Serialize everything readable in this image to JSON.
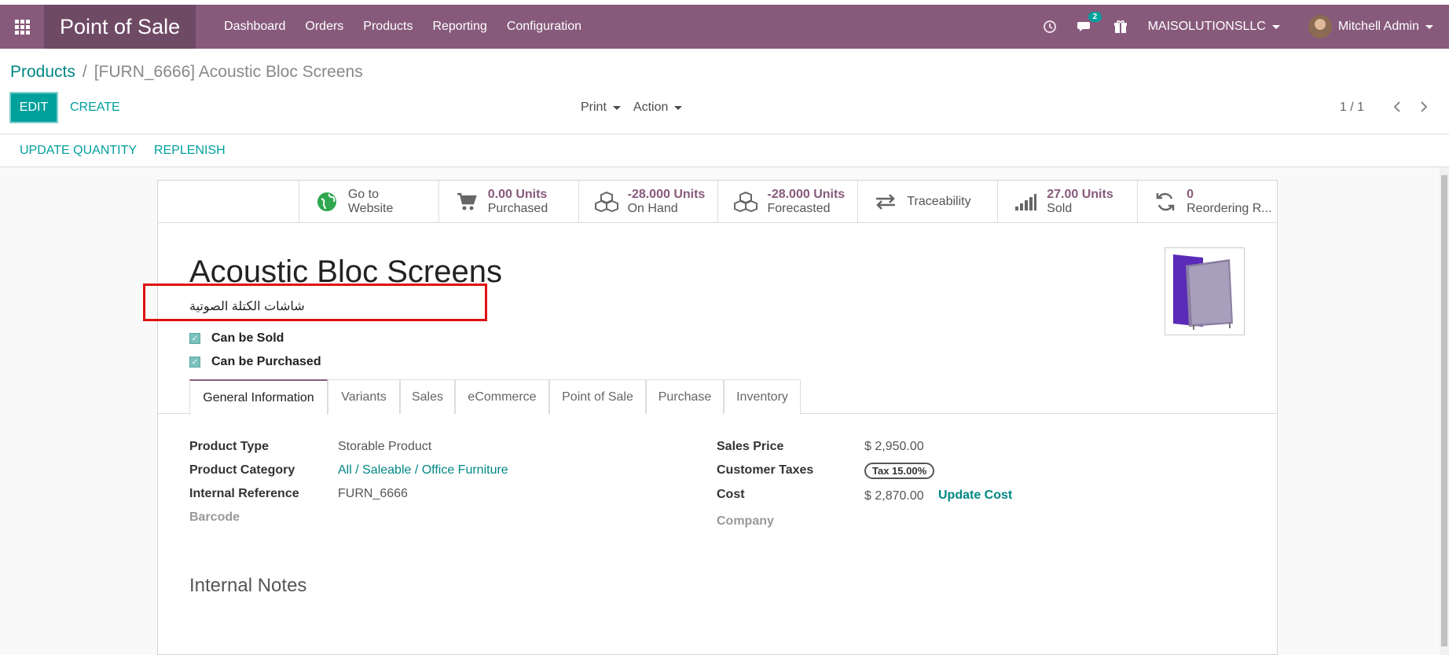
{
  "navbar": {
    "brand": "Point of Sale",
    "menu": [
      "Dashboard",
      "Orders",
      "Products",
      "Reporting",
      "Configuration"
    ],
    "chat_badge": "2",
    "company": "MAISOLUTIONSLLC",
    "user": "Mitchell Admin"
  },
  "breadcrumb": {
    "parent": "Products",
    "separator": "/",
    "current": "[FURN_6666] Acoustic Bloc Screens"
  },
  "toolbar": {
    "edit": "EDIT",
    "create": "CREATE",
    "print": "Print",
    "action": "Action",
    "pager": "1 / 1"
  },
  "statusbar": {
    "update_quantity": "UPDATE QUANTITY",
    "replenish": "REPLENISH"
  },
  "smart_buttons": {
    "website": {
      "line1": "Go to",
      "line2": "Website"
    },
    "purchased": {
      "value": "0.00 Units",
      "label": "Purchased"
    },
    "on_hand": {
      "value": "-28.000 Units",
      "label": "On Hand"
    },
    "forecasted": {
      "value": "-28.000 Units",
      "label": "Forecasted"
    },
    "traceability": {
      "label": "Traceability"
    },
    "sold": {
      "value": "27.00 Units",
      "label": "Sold"
    },
    "reordering": {
      "value": "0",
      "label": "Reordering R..."
    }
  },
  "product": {
    "name": "Acoustic Bloc Screens",
    "name_arabic": "شاشات الكتلة الصوتية",
    "can_be_sold": "Can be Sold",
    "can_be_purchased": "Can be Purchased"
  },
  "tabs": [
    "General Information",
    "Variants",
    "Sales",
    "eCommerce",
    "Point of Sale",
    "Purchase",
    "Inventory"
  ],
  "general": {
    "product_type_label": "Product Type",
    "product_type": "Storable Product",
    "category_label": "Product Category",
    "category": "All / Saleable / Office Furniture",
    "internal_ref_label": "Internal Reference",
    "internal_ref": "FURN_6666",
    "barcode_label": "Barcode",
    "sales_price_label": "Sales Price",
    "sales_price": "$ 2,950.00",
    "taxes_label": "Customer Taxes",
    "tax": "Tax 15.00%",
    "cost_label": "Cost",
    "cost": "$ 2,870.00",
    "update_cost": "Update Cost",
    "company_label": "Company"
  },
  "notes": {
    "title": "Internal Notes"
  },
  "colors": {
    "navbar": "#875a7b",
    "brand_bg": "#6f4a65",
    "accent": "#00a09d",
    "link": "#008784",
    "highlight": "#e01010"
  }
}
